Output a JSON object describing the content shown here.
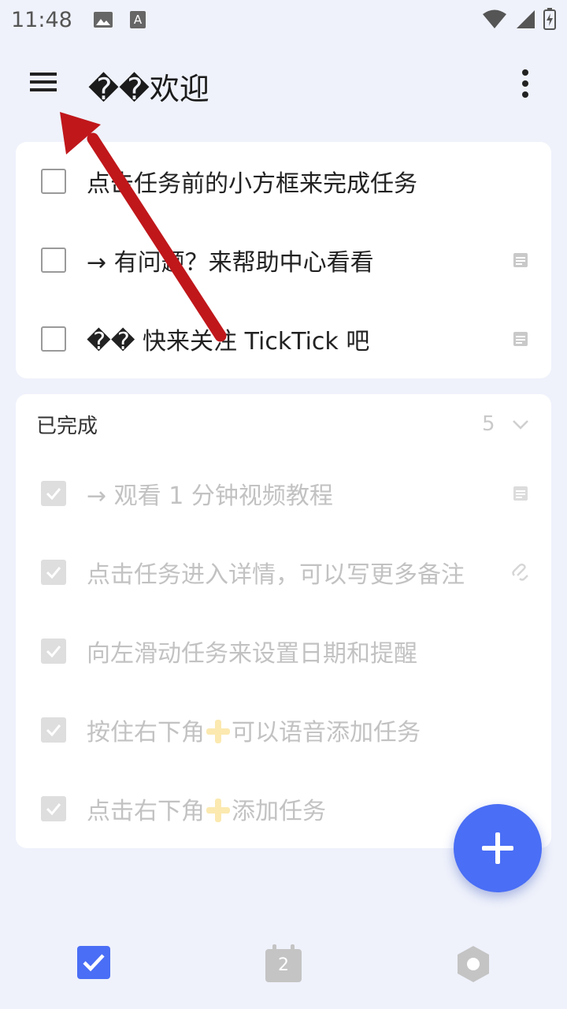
{
  "status_bar": {
    "time": "11:48",
    "icons": [
      "image-icon",
      "a-icon",
      "wifi-icon",
      "signal-icon",
      "battery-charging-icon"
    ]
  },
  "header": {
    "title": "��欢迎",
    "menu_icon": "hamburger-menu-icon",
    "more_icon": "more-vertical-icon"
  },
  "tasks": [
    {
      "text": "点击任务前的小方框来完成任务",
      "has_note": false
    },
    {
      "text": "→ 有问题？来帮助中心看看",
      "has_note": true
    },
    {
      "text": "�� 快来关注 TickTick 吧",
      "has_note": true
    }
  ],
  "completed": {
    "title": "已完成",
    "count": "5",
    "items": [
      {
        "text": "→ 观看 1 分钟视频教程",
        "icon": "note-icon"
      },
      {
        "text": "点击任务进入详情，可以写更多备注",
        "icon": "attachment-icon"
      },
      {
        "text": "向左滑动任务来设置日期和提醒",
        "icon": ""
      },
      {
        "text_before": "按住右下角",
        "text_after": "可以语音添加任务",
        "icon": ""
      },
      {
        "text_before": "点击右下角",
        "text_after": "添加任务",
        "icon": ""
      }
    ]
  },
  "fab": {
    "icon": "plus-icon"
  },
  "bottom_nav": {
    "items": [
      {
        "name": "tasks",
        "icon": "checkbox-icon",
        "active": true
      },
      {
        "name": "calendar",
        "icon": "calendar-icon",
        "badge": "2"
      },
      {
        "name": "habit",
        "icon": "hexagon-icon"
      }
    ]
  },
  "colors": {
    "background": "#eff2fb",
    "card": "#ffffff",
    "accent": "#4a6ef5",
    "arrow": "#c0171b",
    "done_text": "#c2c2c2"
  }
}
